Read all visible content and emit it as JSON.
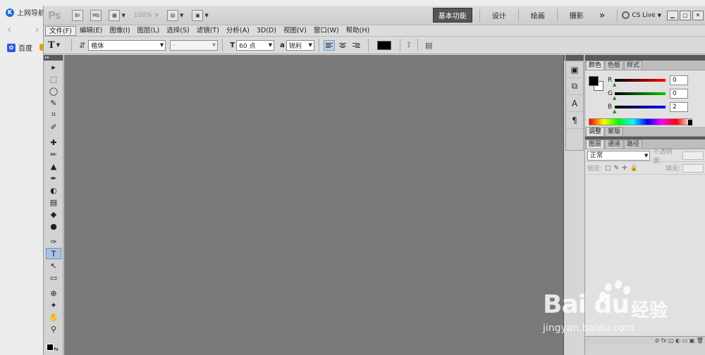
{
  "browser": {
    "tab_title": "上网导航",
    "tab_icon_letter": "K",
    "back_forward": "‹ ›",
    "favorite_label": "百度"
  },
  "appbar": {
    "logo": "Ps",
    "bridge_label": "Br",
    "minibridge_label": "Mb",
    "zoom": "100%",
    "workspaces": [
      "基本功能",
      "设计",
      "绘画",
      "摄影"
    ],
    "more": "»",
    "cslive": "CS Live"
  },
  "menu": {
    "items": [
      "文件(F)",
      "编辑(E)",
      "图像(I)",
      "图层(L)",
      "选择(S)",
      "滤镜(T)",
      "分析(A)",
      "3D(D)",
      "视图(V)",
      "窗口(W)",
      "帮助(H)"
    ]
  },
  "options": {
    "tool_glyph": "T",
    "font_family": "楷体",
    "font_style": "-",
    "font_size": "60 点",
    "size_label": "T",
    "aa_label": "a",
    "antialias": "锐利",
    "text_color": "#000000"
  },
  "tools": {
    "items": [
      "▸",
      "⬚",
      "◯",
      "✎",
      "⌗",
      "✐",
      "✚",
      "✏",
      "▲",
      "✒",
      "◐",
      "▤",
      "◆",
      "●",
      "✑",
      "T",
      "↖",
      "▭",
      "⊕",
      "✦",
      "✋",
      "⚲"
    ],
    "active_index": 15
  },
  "dock": {
    "items": [
      "▣",
      "⧉",
      "A",
      "¶"
    ]
  },
  "color_panel": {
    "tabs": [
      "颜色",
      "色板",
      "样式"
    ],
    "r": "0",
    "g": "0",
    "b": "2",
    "r_label": "R",
    "g_label": "G",
    "b_label": "B"
  },
  "adjust_panel": {
    "tabs": [
      "调整",
      "蒙版"
    ]
  },
  "layers_panel": {
    "tabs": [
      "图层",
      "通道",
      "路径"
    ],
    "blend_mode": "正常",
    "opacity_label": "不透明度:",
    "lock_label": "锁定:",
    "fill_label": "填充:",
    "footer_icons": "⊘ fx ◫ ◐ ▭ ▣ 🗑"
  },
  "watermark": {
    "brand": "Bai du",
    "cn": "经验",
    "url": "jingyan.baidu.com"
  }
}
